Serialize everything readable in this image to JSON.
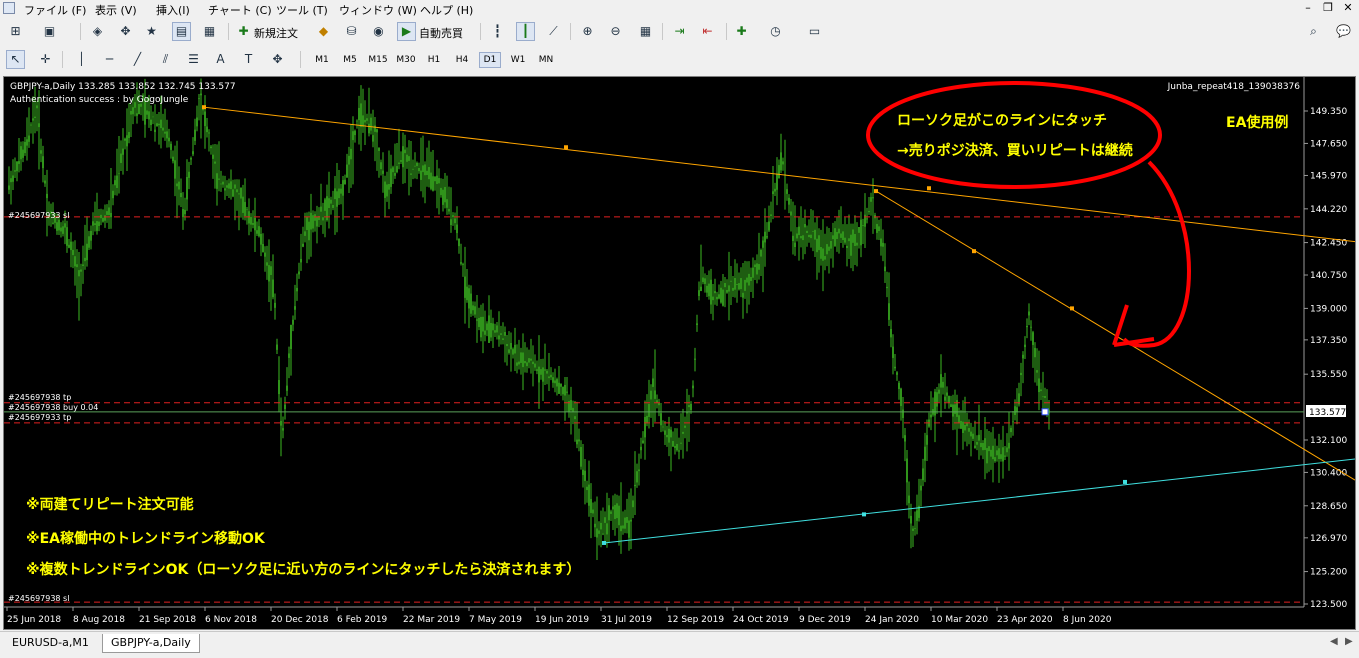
{
  "menu": {
    "items": [
      "ファイル (F)",
      "表示 (V)",
      "挿入(I)",
      "チャート (C)",
      "ツール (T)",
      "ウィンドウ (W)",
      "ヘルプ (H)"
    ]
  },
  "toolbar": {
    "new_order_label": "新規注文",
    "auto_trading_label": "自動売買",
    "timeframes": [
      "M1",
      "M5",
      "M15",
      "M30",
      "H1",
      "H4",
      "D1",
      "W1",
      "MN"
    ],
    "active_timeframe": "D1",
    "text_tool_label": "A",
    "text_label_tool": "T"
  },
  "chart": {
    "symbol_info": "GBPJPY-a,Daily  133.285 133.852 132.745 133.577",
    "auth_text": "Authentication success : by GogoJungle",
    "ea_name": "Junba_repeat418_139038376",
    "current_price": "133.577",
    "colors": {
      "background": "#000000",
      "candle": "#3dba22",
      "resistance_line": "#ffa500",
      "support_line": "#40e0e0",
      "dash_line": "#e02020",
      "bid_line": "#5aa05a",
      "annotation_text": "#ffff00",
      "callout_ellipse": "#ff0000"
    },
    "price_axis": [
      "149.350",
      "147.650",
      "145.970",
      "144.220",
      "142.450",
      "140.750",
      "139.000",
      "137.350",
      "135.550",
      "133.577",
      "132.100",
      "130.400",
      "128.650",
      "126.970",
      "125.200",
      "123.500"
    ],
    "time_axis": [
      "25 Jun 2018",
      "8 Aug 2018",
      "21 Sep 2018",
      "6 Nov 2018",
      "20 Dec 2018",
      "6 Feb 2019",
      "22 Mar 2019",
      "7 May 2019",
      "19 Jun 2019",
      "31 Jul 2019",
      "12 Sep 2019",
      "24 Oct 2019",
      "9 Dec 2019",
      "24 Jan 2020",
      "10 Mar 2020",
      "23 Apr 2020",
      "8 Jun 2020"
    ],
    "order_labels": {
      "sl_upper": "#245697933 sl",
      "tp_938": "#245697938 tp",
      "buy_938": "#245697938 buy 0.04",
      "tp_933": "#245697933 tp",
      "sl_lower": "#245697938 sl"
    },
    "annotations": {
      "callout_line1": "ローソク足がこのラインにタッチ",
      "callout_line2": "→売りポジ決済、買いリピートは継続",
      "ea_example": "EA使用例",
      "note1": "※両建てリピート注文可能",
      "note2": "※EA稼働中のトレンドライン移動OK",
      "note3": "※複数トレンドラインOK（ローソク足に近い方のラインにタッチしたら決済されます）"
    }
  },
  "tabs": [
    {
      "label": "EURUSD-a,M1",
      "active": false
    },
    {
      "label": "GBPJPY-a,Daily",
      "active": true
    }
  ]
}
